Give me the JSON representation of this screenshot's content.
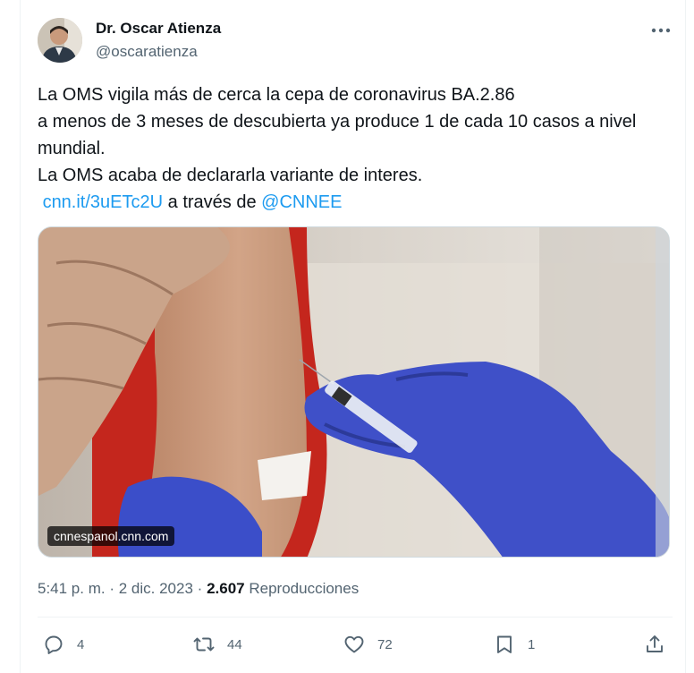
{
  "author": {
    "name": "Dr. Oscar Atienza",
    "handle": "@oscaratienza"
  },
  "tweet": {
    "lines": [
      "La OMS vigila más de cerca la cepa de coronavirus BA.2.86",
      "a menos de 3 meses de descubierta ya produce 1 de cada 10 casos a nivel",
      "mundial.",
      "La OMS acaba de declararla variante de interes."
    ],
    "link_text": "cnn.it/3uETc2U",
    "via_text": "a través de",
    "mention": "@CNNEE"
  },
  "media": {
    "source_label": "cnnespanol.cnn.com"
  },
  "meta": {
    "time": "5:41 p. m.",
    "separator": "·",
    "date": "2 dic. 2023",
    "views_count": "2.607",
    "views_label": "Reproducciones"
  },
  "actions": {
    "replies": "4",
    "reposts": "44",
    "likes": "72",
    "bookmarks": "1"
  },
  "icons": [
    "avatar",
    "more-icon",
    "reply-icon",
    "repost-icon",
    "like-icon",
    "bookmark-icon",
    "share-icon"
  ],
  "colors": {
    "text": "#0f1419",
    "secondary": "#536471",
    "link": "#1d9bf0",
    "border": "#eff3f4"
  }
}
